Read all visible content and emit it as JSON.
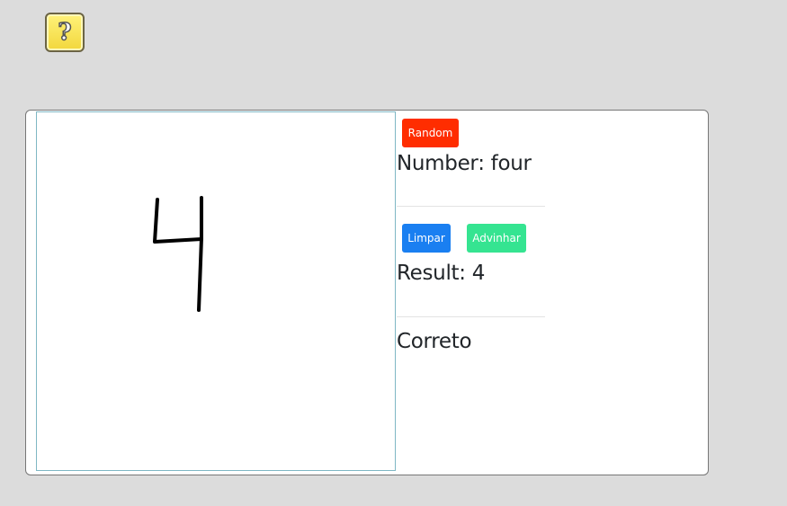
{
  "help": {
    "icon": "question-mark-icon",
    "glyph": "?"
  },
  "controls": {
    "random_label": "Random",
    "limpar_label": "Limpar",
    "advinhar_label": "Advinhar"
  },
  "info": {
    "number_text": "Number: four",
    "result_text": "Result: 4",
    "status_text": "Correto"
  },
  "colors": {
    "random": "#ff2d00",
    "limpar": "#1a7ff1",
    "advinhar": "#35e491",
    "background": "#dcdcdc"
  }
}
